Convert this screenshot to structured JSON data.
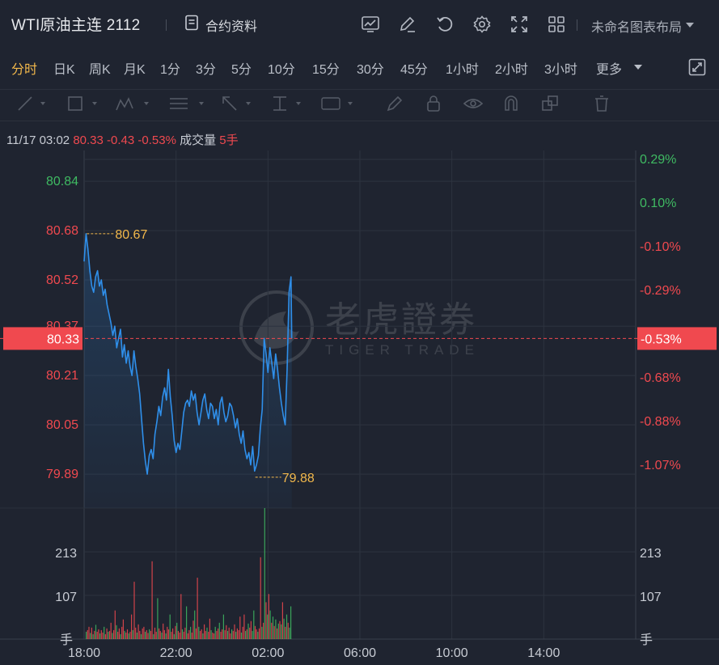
{
  "header": {
    "title": "WTI原油主连 2112",
    "contract_info": "合约资料",
    "layout_name": "未命名图表布局"
  },
  "icons": [
    "trend-icon",
    "edit-icon",
    "refresh-icon",
    "settings-icon",
    "fullscreen-icon",
    "grid-icon",
    "expand-icon"
  ],
  "periods": [
    "分时",
    "日K",
    "周K",
    "月K",
    "1分",
    "3分",
    "5分",
    "10分",
    "15分",
    "30分",
    "45分",
    "1小时",
    "2小时",
    "3小时",
    "更多"
  ],
  "active_period": "分时",
  "info": {
    "datetime": "11/17 03:02",
    "price": "80.33",
    "change": "-0.43",
    "change_pct": "-0.53%",
    "volume_label": "成交量",
    "volume": "5手"
  },
  "watermark": {
    "cn": "老虎證券",
    "en": "TIGER TRADE"
  },
  "colors": {
    "background": "#1f2430",
    "line": "#2f8fea",
    "up": "#3fba62",
    "down": "#f0494f",
    "accent": "#f2b84b",
    "grid": "#2d333f"
  },
  "chart_data": {
    "type": "line",
    "prev_close": 80.76,
    "last_price": 80.33,
    "last_change_pct": "-0.53%",
    "ylim": [
      79.78,
      80.94
    ],
    "y_ticks_left": [
      "80.84",
      "80.68",
      "80.52",
      "80.37",
      "80.21",
      "80.05",
      "79.89"
    ],
    "y_ticks_right": [
      "0.29%",
      "0.10%",
      "-0.10%",
      "-0.29%",
      "-0.48%",
      "-0.68%",
      "-0.88%",
      "-1.07%"
    ],
    "x_ticks": [
      "18:00",
      "22:00",
      "02:00",
      "06:00",
      "10:00",
      "14:00"
    ],
    "max_marker": {
      "time": "18:07",
      "value": 80.67,
      "label": "80.67"
    },
    "min_marker": {
      "time": "01:27",
      "value": 79.88,
      "label": "79.88"
    },
    "price_series": [
      [
        "18:00",
        80.58
      ],
      [
        "18:05",
        80.67
      ],
      [
        "18:10",
        80.62
      ],
      [
        "18:15",
        80.55
      ],
      [
        "18:20",
        80.5
      ],
      [
        "18:25",
        80.48
      ],
      [
        "18:30",
        80.53
      ],
      [
        "18:35",
        80.55
      ],
      [
        "18:40",
        80.5
      ],
      [
        "18:45",
        80.52
      ],
      [
        "18:50",
        80.47
      ],
      [
        "18:55",
        80.49
      ],
      [
        "19:00",
        80.44
      ],
      [
        "19:05",
        80.41
      ],
      [
        "19:10",
        80.38
      ],
      [
        "19:15",
        80.34
      ],
      [
        "19:20",
        80.37
      ],
      [
        "19:25",
        80.3
      ],
      [
        "19:30",
        80.33
      ],
      [
        "19:35",
        80.36
      ],
      [
        "19:40",
        80.27
      ],
      [
        "19:45",
        80.31
      ],
      [
        "19:50",
        80.25
      ],
      [
        "19:55",
        80.29
      ],
      [
        "20:00",
        80.24
      ],
      [
        "20:05",
        80.21
      ],
      [
        "20:10",
        80.29
      ],
      [
        "20:15",
        80.24
      ],
      [
        "20:20",
        80.2
      ],
      [
        "20:25",
        80.15
      ],
      [
        "20:30",
        80.07
      ],
      [
        "20:35",
        79.99
      ],
      [
        "20:40",
        79.93
      ],
      [
        "20:45",
        79.89
      ],
      [
        "20:50",
        79.95
      ],
      [
        "20:55",
        79.97
      ],
      [
        "21:00",
        79.94
      ],
      [
        "21:05",
        80.02
      ],
      [
        "21:10",
        80.06
      ],
      [
        "21:15",
        80.11
      ],
      [
        "21:20",
        80.08
      ],
      [
        "21:25",
        80.14
      ],
      [
        "21:30",
        80.17
      ],
      [
        "21:35",
        80.13
      ],
      [
        "21:40",
        80.23
      ],
      [
        "21:45",
        80.14
      ],
      [
        "21:50",
        80.08
      ],
      [
        "21:55",
        80.0
      ],
      [
        "22:00",
        79.96
      ],
      [
        "22:05",
        79.99
      ],
      [
        "22:10",
        79.97
      ],
      [
        "22:15",
        80.03
      ],
      [
        "22:20",
        80.09
      ],
      [
        "22:25",
        80.12
      ],
      [
        "22:30",
        80.13
      ],
      [
        "22:35",
        80.11
      ],
      [
        "22:40",
        80.16
      ],
      [
        "22:45",
        80.13
      ],
      [
        "22:50",
        80.15
      ],
      [
        "22:55",
        80.09
      ],
      [
        "23:00",
        80.05
      ],
      [
        "23:05",
        80.09
      ],
      [
        "23:10",
        80.13
      ],
      [
        "23:15",
        80.15
      ],
      [
        "23:20",
        80.1
      ],
      [
        "23:25",
        80.07
      ],
      [
        "23:30",
        80.12
      ],
      [
        "23:35",
        80.11
      ],
      [
        "23:40",
        80.07
      ],
      [
        "23:45",
        80.1
      ],
      [
        "23:50",
        80.05
      ],
      [
        "23:55",
        80.12
      ],
      [
        "00:00",
        80.14
      ],
      [
        "00:05",
        80.09
      ],
      [
        "00:10",
        80.06
      ],
      [
        "00:15",
        80.08
      ],
      [
        "00:20",
        80.12
      ],
      [
        "00:25",
        80.11
      ],
      [
        "00:30",
        80.08
      ],
      [
        "00:35",
        80.04
      ],
      [
        "00:40",
        80.07
      ],
      [
        "00:45",
        80.02
      ],
      [
        "00:50",
        79.99
      ],
      [
        "00:55",
        80.03
      ],
      [
        "01:00",
        79.97
      ],
      [
        "01:05",
        79.94
      ],
      [
        "01:10",
        79.96
      ],
      [
        "01:15",
        79.92
      ],
      [
        "01:20",
        79.98
      ],
      [
        "01:25",
        79.9
      ],
      [
        "01:30",
        79.92
      ],
      [
        "01:35",
        79.95
      ],
      [
        "01:40",
        80.04
      ],
      [
        "01:45",
        80.1
      ],
      [
        "01:50",
        80.33
      ],
      [
        "01:55",
        80.28
      ],
      [
        "02:00",
        80.22
      ],
      [
        "02:05",
        80.3
      ],
      [
        "02:10",
        80.25
      ],
      [
        "02:15",
        80.2
      ],
      [
        "02:20",
        80.28
      ],
      [
        "02:25",
        80.23
      ],
      [
        "02:30",
        80.17
      ],
      [
        "02:35",
        80.12
      ],
      [
        "02:40",
        80.08
      ],
      [
        "02:45",
        80.05
      ],
      [
        "02:50",
        80.23
      ],
      [
        "02:55",
        80.48
      ],
      [
        "03:00",
        80.53
      ],
      [
        "03:02",
        80.33
      ]
    ],
    "volume_ticks": [
      "213",
      "107"
    ],
    "volume_unit": "手",
    "volume_max": 320,
    "volume_series": [
      [
        18,
        "up"
      ],
      [
        22,
        "down"
      ],
      [
        30,
        "down"
      ],
      [
        15,
        "up"
      ],
      [
        28,
        "down"
      ],
      [
        12,
        "up"
      ],
      [
        20,
        "down"
      ],
      [
        35,
        "up"
      ],
      [
        18,
        "down"
      ],
      [
        24,
        "down"
      ],
      [
        14,
        "up"
      ],
      [
        22,
        "down"
      ],
      [
        16,
        "down"
      ],
      [
        30,
        "up"
      ],
      [
        12,
        "down"
      ],
      [
        26,
        "down"
      ],
      [
        18,
        "up"
      ],
      [
        20,
        "down"
      ],
      [
        40,
        "down"
      ],
      [
        15,
        "up"
      ],
      [
        22,
        "down"
      ],
      [
        70,
        "down"
      ],
      [
        34,
        "up"
      ],
      [
        18,
        "down"
      ],
      [
        26,
        "down"
      ],
      [
        12,
        "up"
      ],
      [
        30,
        "down"
      ],
      [
        48,
        "down"
      ],
      [
        20,
        "up"
      ],
      [
        16,
        "down"
      ],
      [
        24,
        "down"
      ],
      [
        14,
        "up"
      ],
      [
        18,
        "down"
      ],
      [
        60,
        "down"
      ],
      [
        22,
        "up"
      ],
      [
        140,
        "down"
      ],
      [
        28,
        "down"
      ],
      [
        16,
        "up"
      ],
      [
        36,
        "down"
      ],
      [
        20,
        "down"
      ],
      [
        12,
        "up"
      ],
      [
        26,
        "down"
      ],
      [
        30,
        "down"
      ],
      [
        18,
        "up"
      ],
      [
        22,
        "down"
      ],
      [
        15,
        "down"
      ],
      [
        24,
        "up"
      ],
      [
        20,
        "down"
      ],
      [
        190,
        "down"
      ],
      [
        12,
        "up"
      ],
      [
        28,
        "down"
      ],
      [
        18,
        "down"
      ],
      [
        100,
        "up"
      ],
      [
        26,
        "down"
      ],
      [
        20,
        "down"
      ],
      [
        16,
        "up"
      ],
      [
        38,
        "down"
      ],
      [
        22,
        "down"
      ],
      [
        14,
        "up"
      ],
      [
        30,
        "down"
      ],
      [
        24,
        "down"
      ],
      [
        60,
        "up"
      ],
      [
        18,
        "down"
      ],
      [
        26,
        "down"
      ],
      [
        12,
        "up"
      ],
      [
        32,
        "down"
      ],
      [
        40,
        "up"
      ],
      [
        20,
        "down"
      ],
      [
        16,
        "down"
      ],
      [
        110,
        "down"
      ],
      [
        24,
        "up"
      ],
      [
        18,
        "down"
      ],
      [
        28,
        "down"
      ],
      [
        80,
        "up"
      ],
      [
        14,
        "down"
      ],
      [
        22,
        "down"
      ],
      [
        30,
        "up"
      ],
      [
        16,
        "down"
      ],
      [
        45,
        "down"
      ],
      [
        70,
        "up"
      ],
      [
        26,
        "down"
      ],
      [
        150,
        "down"
      ],
      [
        30,
        "up"
      ],
      [
        20,
        "down"
      ],
      [
        24,
        "down"
      ],
      [
        14,
        "up"
      ],
      [
        36,
        "down"
      ],
      [
        20,
        "down"
      ],
      [
        28,
        "up"
      ],
      [
        18,
        "down"
      ],
      [
        50,
        "down"
      ],
      [
        22,
        "up"
      ],
      [
        16,
        "down"
      ],
      [
        14,
        "down"
      ],
      [
        30,
        "up"
      ],
      [
        20,
        "down"
      ],
      [
        26,
        "down"
      ],
      [
        40,
        "up"
      ],
      [
        18,
        "down"
      ],
      [
        24,
        "down"
      ],
      [
        60,
        "up"
      ],
      [
        22,
        "down"
      ],
      [
        34,
        "down"
      ],
      [
        20,
        "up"
      ],
      [
        28,
        "down"
      ],
      [
        14,
        "down"
      ],
      [
        24,
        "up"
      ],
      [
        20,
        "down"
      ],
      [
        36,
        "down"
      ],
      [
        18,
        "up"
      ],
      [
        26,
        "down"
      ],
      [
        22,
        "down"
      ],
      [
        55,
        "down"
      ],
      [
        16,
        "up"
      ],
      [
        30,
        "down"
      ],
      [
        60,
        "down"
      ],
      [
        20,
        "up"
      ],
      [
        24,
        "down"
      ],
      [
        38,
        "up"
      ],
      [
        28,
        "down"
      ],
      [
        44,
        "down"
      ],
      [
        20,
        "up"
      ],
      [
        70,
        "up"
      ],
      [
        32,
        "down"
      ],
      [
        24,
        "down"
      ],
      [
        18,
        "up"
      ],
      [
        26,
        "down"
      ],
      [
        200,
        "down"
      ],
      [
        30,
        "up"
      ],
      [
        40,
        "down"
      ],
      [
        320,
        "up"
      ],
      [
        90,
        "down"
      ],
      [
        60,
        "up"
      ],
      [
        110,
        "down"
      ],
      [
        70,
        "up"
      ],
      [
        40,
        "down"
      ],
      [
        55,
        "up"
      ],
      [
        32,
        "down"
      ],
      [
        48,
        "up"
      ],
      [
        26,
        "down"
      ],
      [
        38,
        "up"
      ],
      [
        44,
        "down"
      ],
      [
        36,
        "up"
      ],
      [
        90,
        "down"
      ],
      [
        50,
        "up"
      ],
      [
        30,
        "down"
      ],
      [
        60,
        "up"
      ],
      [
        40,
        "down"
      ],
      [
        28,
        "up"
      ],
      [
        80,
        "up"
      ]
    ]
  }
}
